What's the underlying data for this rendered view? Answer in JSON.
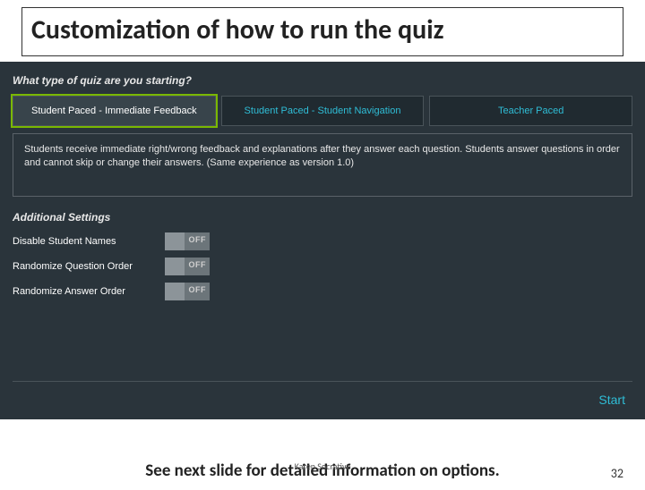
{
  "slide": {
    "title": "Customization of how to run the quiz",
    "footer_text": "See next slide for detailed information on options.",
    "attribution": "Karen Socrative",
    "page_number": "32"
  },
  "panel": {
    "question": "What type of quiz are you starting?",
    "options": [
      {
        "label": "Student Paced - Immediate Feedback",
        "selected": true
      },
      {
        "label": "Student Paced - Student Navigation",
        "selected": false
      },
      {
        "label": "Teacher Paced",
        "selected": false
      }
    ],
    "description": "Students receive immediate right/wrong feedback and explanations after they answer each question. Students answer questions in order and cannot skip or change their answers. (Same experience as version 1.0)",
    "settings_heading": "Additional Settings",
    "settings": [
      {
        "name": "Disable Student Names",
        "state": "OFF"
      },
      {
        "name": "Randomize Question Order",
        "state": "OFF"
      },
      {
        "name": "Randomize Answer Order",
        "state": "OFF"
      }
    ],
    "start_label": "Start"
  }
}
